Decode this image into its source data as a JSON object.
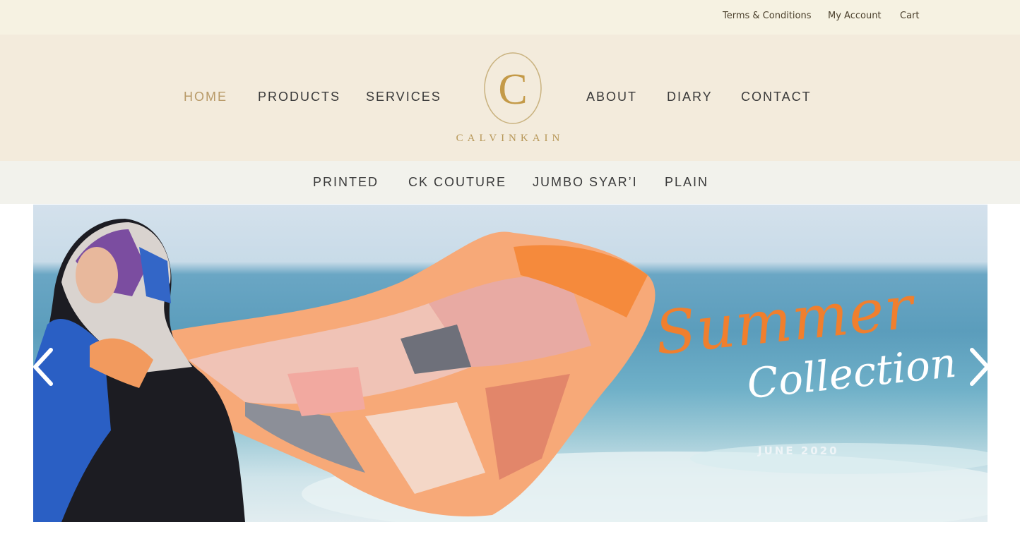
{
  "topbar": {
    "links": [
      "Terms & Conditions",
      "My Account",
      "Cart"
    ]
  },
  "header": {
    "nav_left": [
      "HOME",
      "PRODUCTS",
      "SERVICES"
    ],
    "nav_right": [
      "ABOUT",
      "DIARY",
      "CONTACT"
    ],
    "active_item": "HOME",
    "logo_letter": "C",
    "logo_text": "CALVINKAIN"
  },
  "subnav": {
    "items": [
      "PRINTED",
      "CK COUTURE",
      "JUMBO SYAR’I",
      "PLAIN"
    ]
  },
  "hero": {
    "title": "Summer",
    "subtitle": "Collection",
    "date": "JUNE 2020",
    "prev_icon": "chevron-left-icon",
    "next_icon": "chevron-right-icon"
  },
  "colors": {
    "topbar_bg": "#f6f2e2",
    "header_bg": "#f3ebdc",
    "subnav_bg": "#f2f2ec",
    "accent_gold": "#b89a68",
    "hero_orange": "#f07f2e"
  }
}
